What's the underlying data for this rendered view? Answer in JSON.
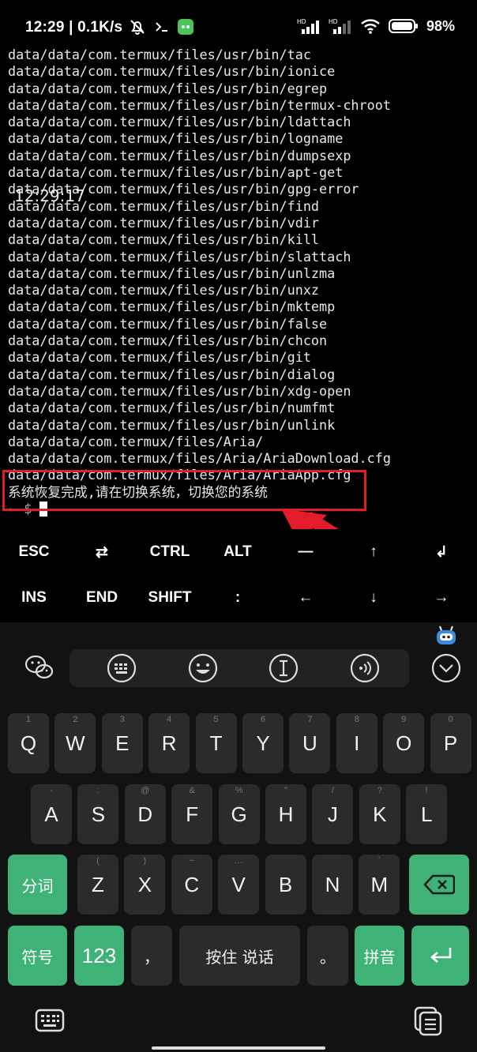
{
  "status_bar": {
    "time_speed": "12:29 | 0.1K/s",
    "battery": "98%",
    "hd1": "HD",
    "hd2": "HD"
  },
  "terminal": {
    "lines": [
      "data/data/com.termux/files/usr/bin/tac",
      "data/data/com.termux/files/usr/bin/ionice",
      "data/data/com.termux/files/usr/bin/egrep",
      "data/data/com.termux/files/usr/bin/termux-chroot",
      "data/data/com.termux/files/usr/bin/ldattach",
      "data/data/com.termux/files/usr/bin/logname",
      "data/data/com.termux/files/usr/bin/dumpsexp",
      "data/data/com.termux/files/usr/bin/apt-get",
      "data/data/com.termux/files/usr/bin/gpg-error",
      "data/data/com.termux/files/usr/bin/find",
      "data/data/com.termux/files/usr/bin/vdir",
      "data/data/com.termux/files/usr/bin/kill",
      "data/data/com.termux/files/usr/bin/slattach",
      "data/data/com.termux/files/usr/bin/unlzma",
      "data/data/com.termux/files/usr/bin/unxz",
      "data/data/com.termux/files/usr/bin/mktemp",
      "data/data/com.termux/files/usr/bin/false",
      "data/data/com.termux/files/usr/bin/chcon",
      "data/data/com.termux/files/usr/bin/git",
      "data/data/com.termux/files/usr/bin/dialog",
      "data/data/com.termux/files/usr/bin/xdg-open",
      "data/data/com.termux/files/usr/bin/numfmt",
      "data/data/com.termux/files/usr/bin/unlink",
      "data/data/com.termux/files/Aria/",
      "data/data/com.termux/files/Aria/AriaDownload.cfg",
      "data/data/com.termux/files/Aria/AriaApp.cfg",
      "系统恢复完成,请在切换系统，切换您的系统"
    ],
    "prompt": "~ $",
    "overlay_time": "12:29:17"
  },
  "extra_keys": {
    "row1": [
      "ESC",
      "⇄",
      "CTRL",
      "ALT",
      "—",
      "↑",
      "↲"
    ],
    "row2": [
      "INS",
      "END",
      "SHIFT",
      ":",
      "←",
      "↓",
      "→"
    ]
  },
  "keyboard": {
    "row1": [
      {
        "k": "Q",
        "h": "1"
      },
      {
        "k": "W",
        "h": "2"
      },
      {
        "k": "E",
        "h": "3"
      },
      {
        "k": "R",
        "h": "4"
      },
      {
        "k": "T",
        "h": "5"
      },
      {
        "k": "Y",
        "h": "6"
      },
      {
        "k": "U",
        "h": "7"
      },
      {
        "k": "I",
        "h": "8"
      },
      {
        "k": "O",
        "h": "9"
      },
      {
        "k": "P",
        "h": "0"
      }
    ],
    "row2": [
      {
        "k": "A",
        "h": "-"
      },
      {
        "k": "S",
        "h": ":"
      },
      {
        "k": "D",
        "h": "@"
      },
      {
        "k": "F",
        "h": "&"
      },
      {
        "k": "G",
        "h": "%"
      },
      {
        "k": "H",
        "h": "\""
      },
      {
        "k": "J",
        "h": "/"
      },
      {
        "k": "K",
        "h": "?"
      },
      {
        "k": "L",
        "h": "!"
      }
    ],
    "row3": [
      {
        "k": "Z",
        "h": "("
      },
      {
        "k": "X",
        "h": ")"
      },
      {
        "k": "C",
        "h": "~"
      },
      {
        "k": "V",
        "h": "…"
      },
      {
        "k": "B",
        "h": ""
      },
      {
        "k": "N",
        "h": ""
      },
      {
        "k": "M",
        "h": "`"
      }
    ],
    "fenci": "分词",
    "fuhao": "符号",
    "num": "123",
    "comma": "，",
    "voice": "按住 说话",
    "period": "。",
    "pinyin": "拼音"
  },
  "colors": {
    "highlight": "#e11d2a",
    "key_green": "#3fb277",
    "key_dark": "#2b2b2b"
  }
}
